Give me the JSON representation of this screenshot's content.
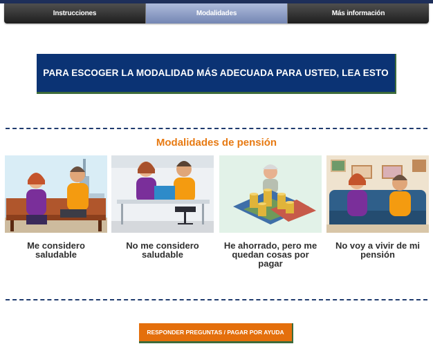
{
  "tabs": [
    {
      "label": "Instrucciones"
    },
    {
      "label": "Modalidades"
    },
    {
      "label": "Más información"
    }
  ],
  "banner": {
    "text": "PARA ESCOGER LA MODALIDAD MÁS ADECUADA PARA USTED, LEA ESTO"
  },
  "section": {
    "title": "Modalidades de pensión"
  },
  "cards": [
    {
      "caption": "Me considero saludable"
    },
    {
      "caption": "No me considero saludable"
    },
    {
      "caption": "He ahorrado, pero me quedan cosas por pagar"
    },
    {
      "caption": "No voy a vivir de mi pensión"
    }
  ],
  "cta": {
    "label": "RESPONDER PREGUNTAS / PAGAR POR AYUDA"
  },
  "colors": {
    "navy": "#0b3374",
    "orange": "#e77a13",
    "tab_active": "#8fa0c8"
  }
}
